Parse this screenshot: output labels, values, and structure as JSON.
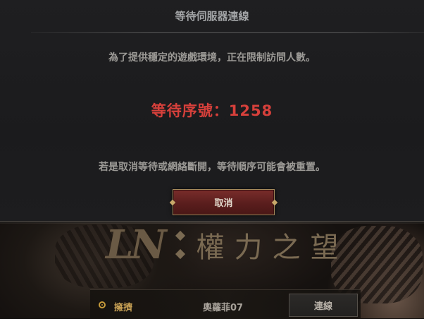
{
  "dialog": {
    "title": "等待伺服器連線",
    "message_top": "為了提供穩定的遊戲環境，正在限制訪問人數。",
    "queue_text": "等待序號：1258",
    "message_bottom": "若是取消等待或網絡斷開，等待順序可能會被重置。",
    "cancel_label": "取消"
  },
  "background": {
    "logo_mark": "LN",
    "logo_text": "權力之望"
  },
  "character_row": {
    "icon": "ring-icon",
    "label": "擁擠",
    "name": "奧蘿菲07",
    "connect_label": "連線"
  },
  "colors": {
    "queue_red": "#d6403b",
    "status_gold": "#c8a155",
    "button_red": "#6a2524"
  }
}
